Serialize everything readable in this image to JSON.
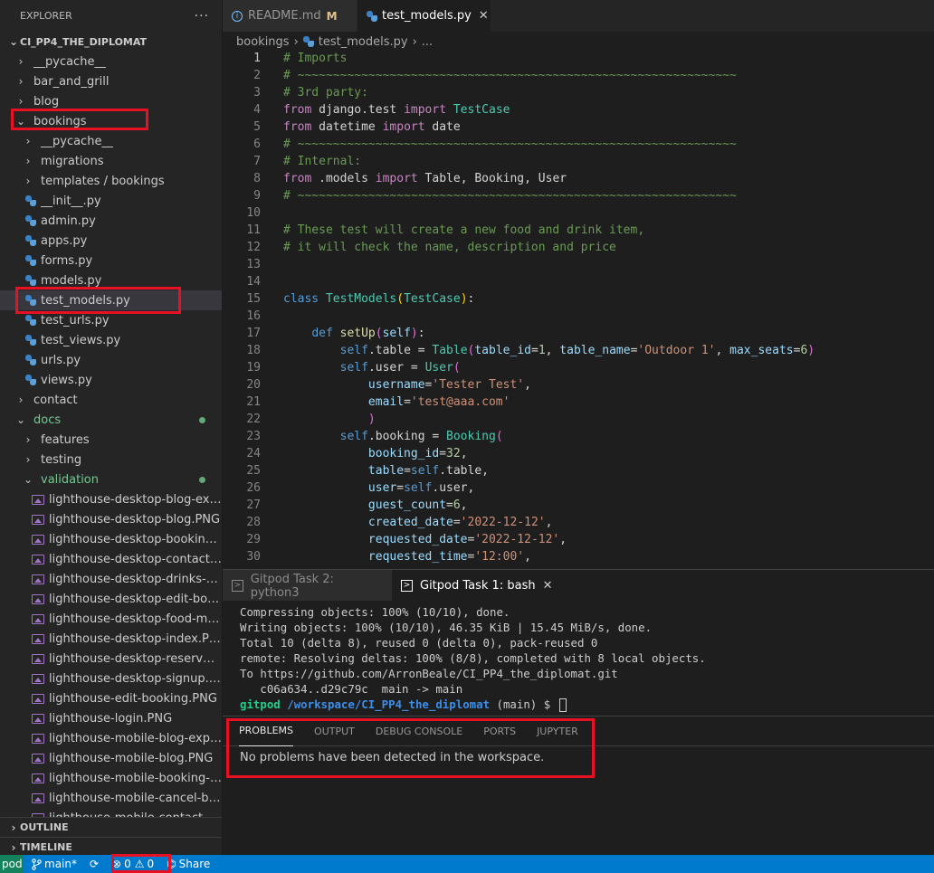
{
  "explorer": {
    "title": "EXPLORER",
    "more": "···",
    "project": "CI_PP4_THE_DIPLOMAT",
    "tree": [
      {
        "label": "__pycache__",
        "indent": 0,
        "kind": "folder",
        "state": "closed"
      },
      {
        "label": "bar_and_grill",
        "indent": 0,
        "kind": "folder",
        "state": "closed"
      },
      {
        "label": "blog",
        "indent": 0,
        "kind": "folder",
        "state": "closed"
      },
      {
        "label": "bookings",
        "indent": 0,
        "kind": "folder",
        "state": "open"
      },
      {
        "label": "__pycache__",
        "indent": 1,
        "kind": "folder",
        "state": "closed"
      },
      {
        "label": "migrations",
        "indent": 1,
        "kind": "folder",
        "state": "closed"
      },
      {
        "label": "templates / bookings",
        "indent": 1,
        "kind": "folder",
        "state": "closed"
      },
      {
        "label": "__init__.py",
        "indent": 1,
        "kind": "py"
      },
      {
        "label": "admin.py",
        "indent": 1,
        "kind": "py"
      },
      {
        "label": "apps.py",
        "indent": 1,
        "kind": "py"
      },
      {
        "label": "forms.py",
        "indent": 1,
        "kind": "py"
      },
      {
        "label": "models.py",
        "indent": 1,
        "kind": "py"
      },
      {
        "label": "test_models.py",
        "indent": 1,
        "kind": "py",
        "selected": true
      },
      {
        "label": "test_urls.py",
        "indent": 1,
        "kind": "py"
      },
      {
        "label": "test_views.py",
        "indent": 1,
        "kind": "py"
      },
      {
        "label": "urls.py",
        "indent": 1,
        "kind": "py"
      },
      {
        "label": "views.py",
        "indent": 1,
        "kind": "py"
      },
      {
        "label": "contact",
        "indent": 0,
        "kind": "folder",
        "state": "closed"
      },
      {
        "label": "docs",
        "indent": 0,
        "kind": "folder",
        "state": "open",
        "modified": true
      },
      {
        "label": "features",
        "indent": 1,
        "kind": "folder",
        "state": "closed"
      },
      {
        "label": "testing",
        "indent": 1,
        "kind": "folder",
        "state": "closed"
      },
      {
        "label": "validation",
        "indent": 1,
        "kind": "folder",
        "state": "open",
        "modified": true
      },
      {
        "label": "lighthouse-desktop-blog-expa...",
        "indent": 2,
        "kind": "img"
      },
      {
        "label": "lighthouse-desktop-blog.PNG",
        "indent": 2,
        "kind": "img"
      },
      {
        "label": "lighthouse-desktop-booking-lis...",
        "indent": 2,
        "kind": "img"
      },
      {
        "label": "lighthouse-desktop-contact-us....",
        "indent": 2,
        "kind": "img"
      },
      {
        "label": "lighthouse-desktop-drinks-men...",
        "indent": 2,
        "kind": "img"
      },
      {
        "label": "lighthouse-desktop-edit-booki...",
        "indent": 2,
        "kind": "img"
      },
      {
        "label": "lighthouse-desktop-food-menu...",
        "indent": 2,
        "kind": "img"
      },
      {
        "label": "lighthouse-desktop-index.PNG",
        "indent": 2,
        "kind": "img"
      },
      {
        "label": "lighthouse-desktop-reservation...",
        "indent": 2,
        "kind": "img"
      },
      {
        "label": "lighthouse-desktop-signup.PNG",
        "indent": 2,
        "kind": "img"
      },
      {
        "label": "lighthouse-edit-booking.PNG",
        "indent": 2,
        "kind": "img"
      },
      {
        "label": "lighthouse-login.PNG",
        "indent": 2,
        "kind": "img"
      },
      {
        "label": "lighthouse-mobile-blog-expan...",
        "indent": 2,
        "kind": "img"
      },
      {
        "label": "lighthouse-mobile-blog.PNG",
        "indent": 2,
        "kind": "img"
      },
      {
        "label": "lighthouse-mobile-booking-list...",
        "indent": 2,
        "kind": "img"
      },
      {
        "label": "lighthouse-mobile-cancel-book...",
        "indent": 2,
        "kind": "img"
      },
      {
        "label": "lighthouse-mobile-contact-us.P...",
        "indent": 2,
        "kind": "img"
      }
    ],
    "outline": "OUTLINE",
    "timeline": "TIMELINE"
  },
  "tabs": [
    {
      "label": "README.md",
      "badge": "M",
      "active": false
    },
    {
      "label": "test_models.py",
      "active": true,
      "close": "✕"
    }
  ],
  "breadcrumb": {
    "folder": "bookings",
    "file": "test_models.py",
    "more": "..."
  },
  "code": {
    "current_line": 1,
    "lines": [
      [
        [
          "# Imports",
          "com"
        ]
      ],
      [
        [
          "# ~~~~~~~~~~~~~~~~~~~~~~~~~~~~~~~~~~~~~~~~~~~~~~~~~~~~~~~~~~~~~~",
          "com"
        ]
      ],
      [
        [
          "# 3rd party:",
          "com"
        ]
      ],
      [
        [
          "from",
          "kw2"
        ],
        [
          " django.test ",
          ""
        ],
        [
          "import",
          "kw2"
        ],
        [
          " ",
          ""
        ],
        [
          "TestCase",
          "cls"
        ]
      ],
      [
        [
          "from",
          "kw2"
        ],
        [
          " datetime ",
          ""
        ],
        [
          "import",
          "kw2"
        ],
        [
          " date",
          ""
        ]
      ],
      [
        [
          "# ~~~~~~~~~~~~~~~~~~~~~~~~~~~~~~~~~~~~~~~~~~~~~~~~~~~~~~~~~~~~~~",
          "com"
        ]
      ],
      [
        [
          "# Internal:",
          "com"
        ]
      ],
      [
        [
          "from",
          "kw2"
        ],
        [
          " .models ",
          ""
        ],
        [
          "import",
          "kw2"
        ],
        [
          " Table, Booking, User",
          ""
        ]
      ],
      [
        [
          "# ~~~~~~~~~~~~~~~~~~~~~~~~~~~~~~~~~~~~~~~~~~~~~~~~~~~~~~~~~~~~~~",
          "com"
        ]
      ],
      [],
      [
        [
          "# These test will create a new food and drink item,",
          "com"
        ]
      ],
      [
        [
          "# it will check the name, description and price",
          "com"
        ]
      ],
      [],
      [],
      [
        [
          "class",
          "kw"
        ],
        [
          " ",
          ""
        ],
        [
          "TestModels",
          "cls"
        ],
        [
          "(",
          "pn"
        ],
        [
          "TestCase",
          "cls"
        ],
        [
          ")",
          "pn"
        ],
        [
          ":",
          ""
        ]
      ],
      [],
      [
        [
          "    ",
          ""
        ],
        [
          "def",
          "kw"
        ],
        [
          " ",
          ""
        ],
        [
          "setUp",
          "fn"
        ],
        [
          "(",
          "pn2"
        ],
        [
          "self",
          "var"
        ],
        [
          ")",
          "pn2"
        ],
        [
          ":",
          ""
        ]
      ],
      [
        [
          "        ",
          ""
        ],
        [
          "self",
          "kw"
        ],
        [
          ".table = ",
          ""
        ],
        [
          "Table",
          "cls"
        ],
        [
          "(",
          "pn2"
        ],
        [
          "table_id",
          "var"
        ],
        [
          "=",
          ""
        ],
        [
          "1",
          "num"
        ],
        [
          ", ",
          ""
        ],
        [
          "table_name",
          "var"
        ],
        [
          "=",
          ""
        ],
        [
          "'Outdoor 1'",
          "str"
        ],
        [
          ", ",
          ""
        ],
        [
          "max_seats",
          "var"
        ],
        [
          "=",
          ""
        ],
        [
          "6",
          "num"
        ],
        [
          ")",
          "pn2"
        ]
      ],
      [
        [
          "        ",
          ""
        ],
        [
          "self",
          "kw"
        ],
        [
          ".user = ",
          ""
        ],
        [
          "User",
          "cls"
        ],
        [
          "(",
          "pn2"
        ]
      ],
      [
        [
          "            ",
          ""
        ],
        [
          "username",
          "var"
        ],
        [
          "=",
          ""
        ],
        [
          "'Tester Test'",
          "str"
        ],
        [
          ",",
          ""
        ]
      ],
      [
        [
          "            ",
          ""
        ],
        [
          "email",
          "var"
        ],
        [
          "=",
          ""
        ],
        [
          "'test@aaa.com'",
          "str"
        ]
      ],
      [
        [
          "            ",
          ""
        ],
        [
          ")",
          "pn2"
        ]
      ],
      [
        [
          "        ",
          ""
        ],
        [
          "self",
          "kw"
        ],
        [
          ".booking = ",
          ""
        ],
        [
          "Booking",
          "cls"
        ],
        [
          "(",
          "pn2"
        ]
      ],
      [
        [
          "            ",
          ""
        ],
        [
          "booking_id",
          "var"
        ],
        [
          "=",
          ""
        ],
        [
          "32",
          "num"
        ],
        [
          ",",
          ""
        ]
      ],
      [
        [
          "            ",
          ""
        ],
        [
          "table",
          "var"
        ],
        [
          "=",
          ""
        ],
        [
          "self",
          "kw"
        ],
        [
          ".table,",
          ""
        ]
      ],
      [
        [
          "            ",
          ""
        ],
        [
          "user",
          "var"
        ],
        [
          "=",
          ""
        ],
        [
          "self",
          "kw"
        ],
        [
          ".user,",
          ""
        ]
      ],
      [
        [
          "            ",
          ""
        ],
        [
          "guest_count",
          "var"
        ],
        [
          "=",
          ""
        ],
        [
          "6",
          "num"
        ],
        [
          ",",
          ""
        ]
      ],
      [
        [
          "            ",
          ""
        ],
        [
          "created_date",
          "var"
        ],
        [
          "=",
          ""
        ],
        [
          "'2022-12-12'",
          "str"
        ],
        [
          ",",
          ""
        ]
      ],
      [
        [
          "            ",
          ""
        ],
        [
          "requested_date",
          "var"
        ],
        [
          "=",
          ""
        ],
        [
          "'2022-12-12'",
          "str"
        ],
        [
          ",",
          ""
        ]
      ],
      [
        [
          "            ",
          ""
        ],
        [
          "requested_time",
          "var"
        ],
        [
          "=",
          ""
        ],
        [
          "'12:00'",
          "str"
        ],
        [
          ",",
          ""
        ]
      ]
    ]
  },
  "terminal": {
    "tabs": [
      {
        "label": "Gitpod Task 2: python3",
        "active": false
      },
      {
        "label": "Gitpod Task 1: bash",
        "active": true,
        "close": "✕"
      }
    ],
    "lines": [
      "Compressing objects: 100% (10/10), done.",
      "Writing objects: 100% (10/10), 46.35 KiB | 15.45 MiB/s, done.",
      "Total 10 (delta 8), reused 0 (delta 0), pack-reused 0",
      "remote: Resolving deltas: 100% (8/8), completed with 8 local objects.",
      "To https://github.com/ArronBeale/CI_PP4_the_diplomat.git",
      "   c06a634..d29c79c  main -> main"
    ],
    "prompt": {
      "user": "gitpod",
      "path": "/workspace/CI_PP4_the_diplomat",
      "branch": "(main) $ "
    }
  },
  "panel": {
    "tabs": [
      "PROBLEMS",
      "OUTPUT",
      "DEBUG CONSOLE",
      "PORTS",
      "JUPYTER"
    ],
    "active_tab": "PROBLEMS",
    "message": "No problems have been detected in the workspace."
  },
  "statusbar": {
    "remote": "pod",
    "branch": "main*",
    "errors": "0",
    "warnings": "0",
    "share": "Share"
  },
  "colors": {
    "accent": "#007acc",
    "highlight": "#e81123",
    "git_modified": "#73c991"
  }
}
